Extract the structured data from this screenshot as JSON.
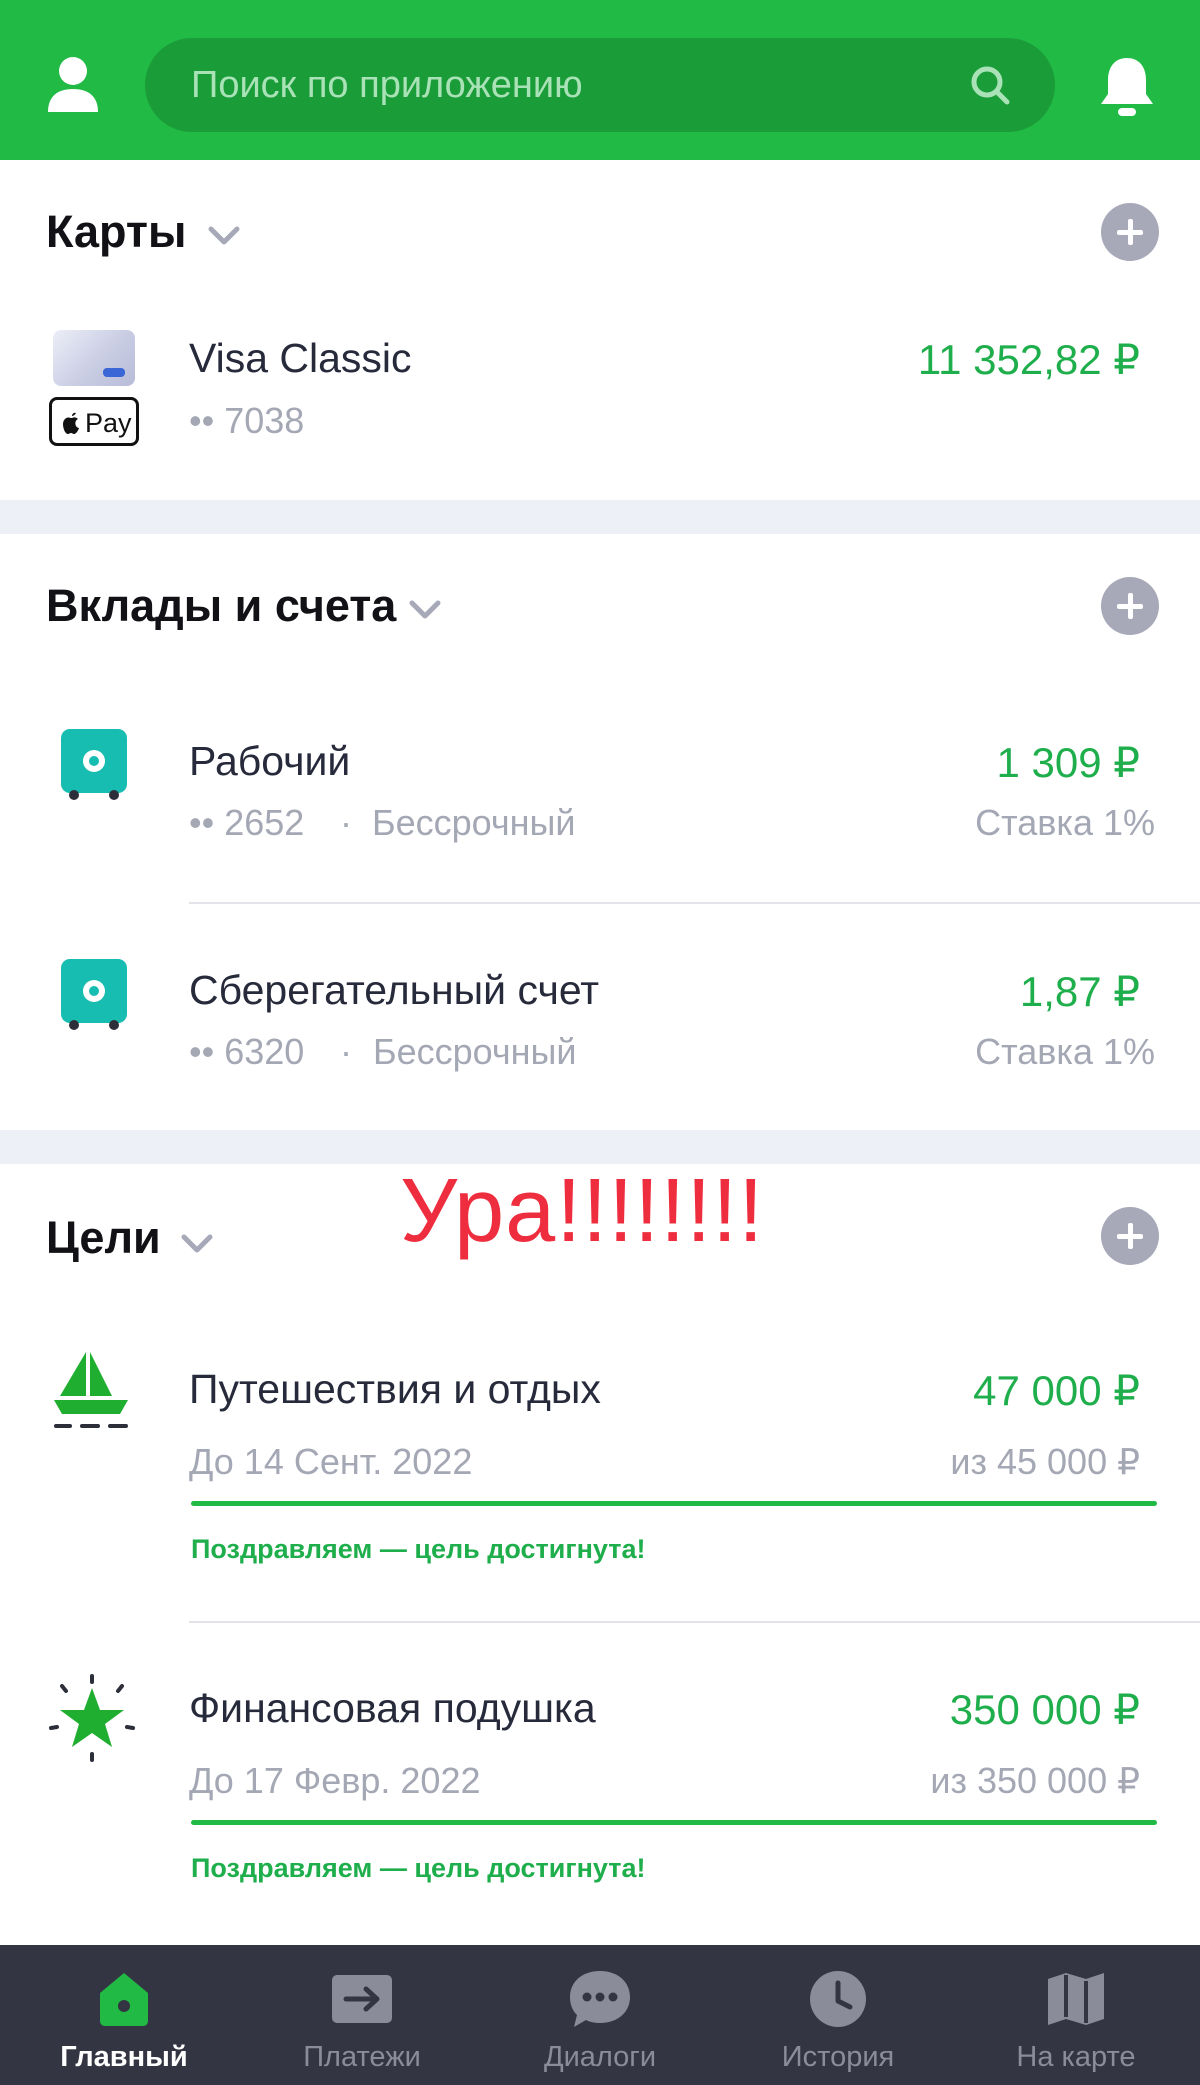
{
  "search": {
    "placeholder": "Поиск по приложению"
  },
  "cards": {
    "title": "Карты",
    "items": [
      {
        "name": "Visa Classic",
        "masked": "•• 7038",
        "amount": "11 352,82 ₽",
        "badge": "Pay"
      }
    ]
  },
  "deposits": {
    "title": "Вклады и счета",
    "items": [
      {
        "name": "Рабочий",
        "masked": "•• 2652",
        "term": "Бессрочный",
        "amount": "1 309 ₽",
        "rate": "Ставка 1%"
      },
      {
        "name": "Сберегательный счет",
        "masked": "•• 6320",
        "term": "Бессрочный",
        "amount": "1,87 ₽",
        "rate": "Ставка 1%"
      }
    ]
  },
  "annotation": "Ура!!!!!!!!",
  "goals": {
    "title": "Цели",
    "items": [
      {
        "name": "Путешествия и отдых",
        "deadline": "До 14 Сент. 2022",
        "amount": "47 000 ₽",
        "target": "из 45 000 ₽",
        "progress": 1.0,
        "status": "Поздравляем — цель достигнута!",
        "icon": "sailboat-icon"
      },
      {
        "name": "Финансовая подушка",
        "deadline": "До 17 Февр. 2022",
        "amount": "350 000 ₽",
        "target": "из 350 000 ₽",
        "progress": 1.0,
        "status": "Поздравляем — цель достигнута!",
        "icon": "star-icon"
      }
    ]
  },
  "nav": {
    "items": [
      {
        "label": "Главный",
        "icon": "home-icon",
        "active": true
      },
      {
        "label": "Платежи",
        "icon": "payments-icon",
        "active": false
      },
      {
        "label": "Диалоги",
        "icon": "chat-icon",
        "active": false
      },
      {
        "label": "История",
        "icon": "clock-icon",
        "active": false
      },
      {
        "label": "На карте",
        "icon": "map-icon",
        "active": false
      }
    ]
  },
  "colors": {
    "brand": "#21ba45",
    "amount": "#1fae4c",
    "annotation": "#ee2e3f",
    "nav_bg": "#343542"
  }
}
